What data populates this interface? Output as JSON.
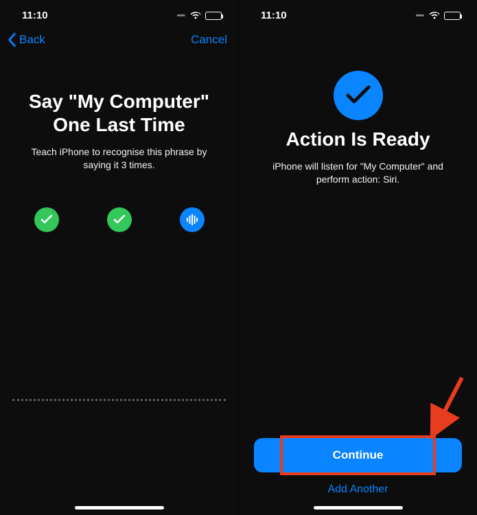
{
  "statusBar": {
    "time": "11:10"
  },
  "left": {
    "nav": {
      "back": "Back",
      "cancel": "Cancel"
    },
    "titleLine1": "Say \"My Computer\"",
    "titleLine2": "One Last Time",
    "subtitle": "Teach iPhone to recognise this phrase by saying it 3 times.",
    "steps": [
      {
        "state": "done"
      },
      {
        "state": "done"
      },
      {
        "state": "active"
      }
    ]
  },
  "right": {
    "title": "Action Is Ready",
    "subtitle": "iPhone will listen for \"My Computer\" and perform action: Siri.",
    "continueLabel": "Continue",
    "addAnotherLabel": "Add Another"
  }
}
